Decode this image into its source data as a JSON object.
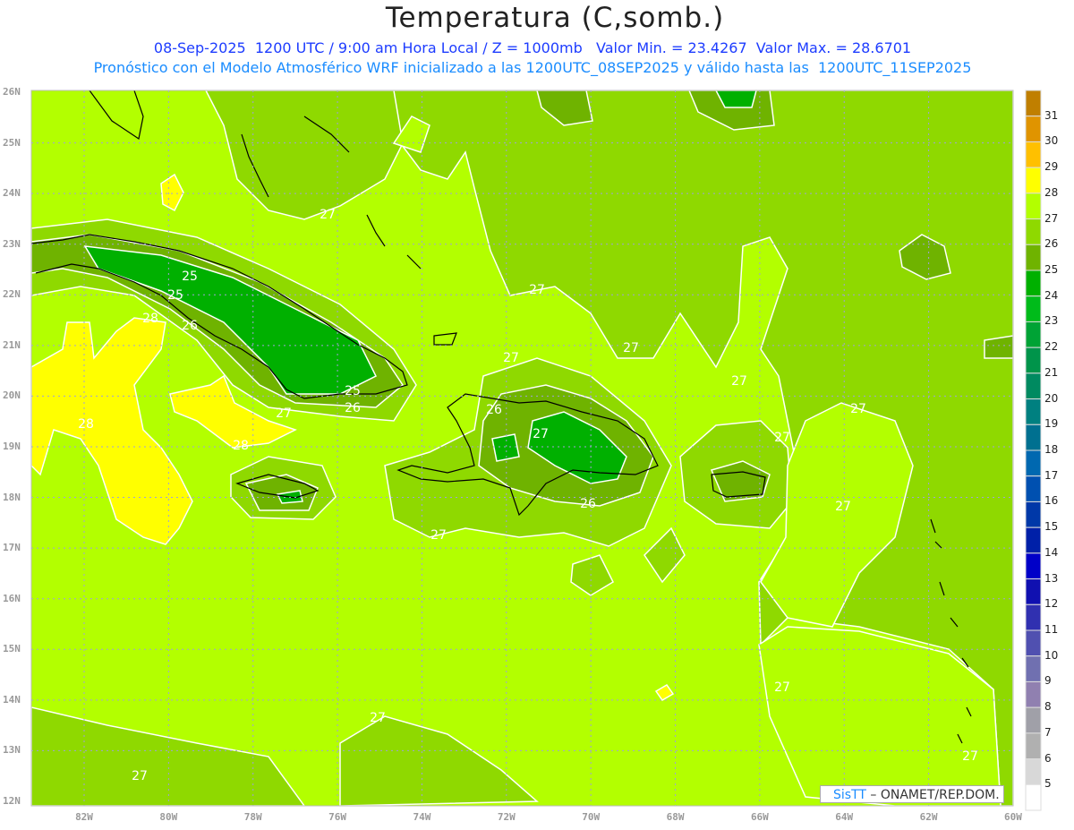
{
  "header": {
    "title": "Temperatura (C,somb.)",
    "line1": "08-Sep-2025  1200 UTC / 9:00 am Hora Local / Z = 1000mb   Valor Min. = 23.4267  Valor Max. = 28.6701",
    "line2": "Pronóstico con el Modelo Atmosférico WRF inicializado a las 1200UTC_08SEP2025 y válido hasta las  1200UTC_11SEP2025"
  },
  "axes": {
    "lat_labels": [
      "26N",
      "25N",
      "24N",
      "23N",
      "22N",
      "21N",
      "20N",
      "19N",
      "18N",
      "17N",
      "16N",
      "15N",
      "14N",
      "13N",
      "12N"
    ],
    "lon_labels": [
      "82W",
      "80W",
      "78W",
      "76W",
      "74W",
      "72W",
      "70W",
      "68W",
      "66W",
      "64W",
      "62W",
      "60W"
    ]
  },
  "colorbar": {
    "labels": [
      "31",
      "30",
      "29",
      "28",
      "27",
      "26",
      "25",
      "24",
      "23",
      "22",
      "21",
      "20",
      "19",
      "18",
      "17",
      "16",
      "15",
      "14",
      "13",
      "12",
      "11",
      "10",
      "9",
      "8",
      "7",
      "6",
      "5"
    ],
    "colors": [
      "#c07f00",
      "#e09400",
      "#ffc000",
      "#ffff00",
      "#b3ff00",
      "#8fd900",
      "#6fb300",
      "#00b000",
      "#00bb1a",
      "#00a335",
      "#00944a",
      "#008a60",
      "#008080",
      "#007090",
      "#0068b0",
      "#0050b0",
      "#0038a8",
      "#0020a8",
      "#0000c8",
      "#1010b0",
      "#3030b0",
      "#5050b0",
      "#7070b0",
      "#9080b0",
      "#a0a0a8",
      "#b0b0b0",
      "#d8d8d8",
      "#ffffff"
    ]
  },
  "map": {
    "contour_labels": [
      "27",
      "25",
      "25",
      "28",
      "26",
      "25",
      "26",
      "27",
      "28",
      "28",
      "27",
      "27",
      "27",
      "27",
      "27",
      "26",
      "26",
      "27",
      "27",
      "27",
      "27",
      "27",
      "27",
      "27",
      "27"
    ]
  },
  "credit": {
    "brand": "SisTT",
    "text": " – ONAMET/REP.DOM."
  }
}
